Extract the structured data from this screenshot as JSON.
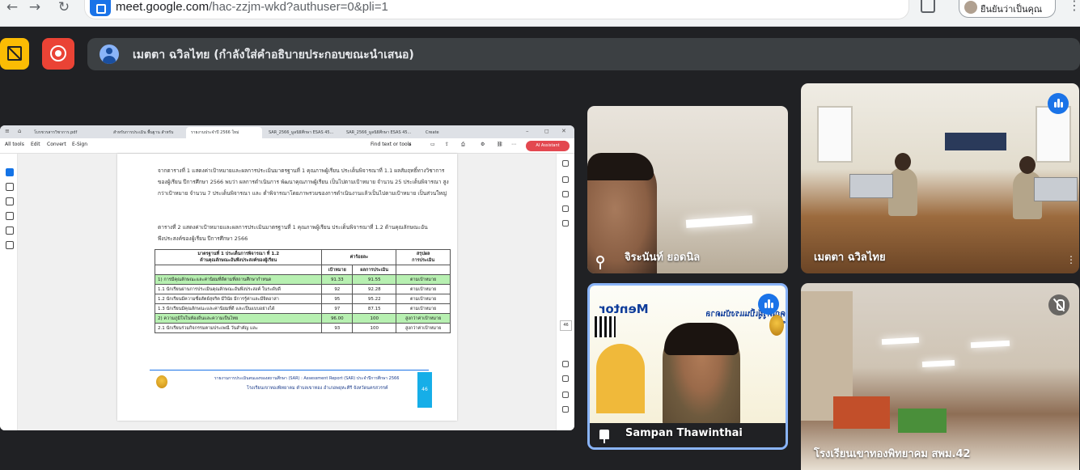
{
  "browser": {
    "url_host": "meet.google.com",
    "url_path": "/hac-zzjm-wkd?authuser=0&pli=1",
    "profile_label": "ยืนยันว่าเป็นคุณ"
  },
  "meet": {
    "presenter_title": "เมตตา ฉวิลไทย (กำลังใส่คำอธิบายประกอบขณะนำเสนอ)",
    "participants": [
      {
        "name": "จิระนันท์ ยอดนิล"
      },
      {
        "name": "เมตตา ฉวิลไทย"
      },
      {
        "name": "Sampan Thawinthai"
      },
      {
        "name": "โรงเรียนเขาทองพิทยาคม สพม.42"
      }
    ],
    "colors": {
      "accent": "#1a73e8",
      "record": "#ea4335",
      "warning": "#fbbc04",
      "pinned_border": "#8ab4f8"
    }
  },
  "shared_screen": {
    "tabs": [
      "โบรชวรสารวิชาการ.pdf",
      "สำหรับการประเมิน พื้นฐาน สำหรับ",
      "รายงานประจำปี 2566 ใหม่",
      "SAR_2566_มูลนิธิศึกษา ESAS 45...",
      "SAR_2566_มูลนิธิศึกษา ESAS 45...",
      "Create"
    ],
    "menu": [
      "All tools",
      "Edit",
      "Convert",
      "E-Sign"
    ],
    "find_text": "Find text or tools",
    "ai_assistant": "AI Assistant",
    "page_number": "46",
    "doc": {
      "para1": "จากตารางที่ 1 แสดงค่าเป้าหมายและผลการประเมินมาตรฐานที่ 1 คุณภาพผู้เรียน ประเด็นพิจารณาที่ 1.1 ผลสัมฤทธิ์ทางวิชาการของผู้เรียน ปีการศึกษา 2566 พบว่า ผลการดำเนินการ พัฒนาคุณภาพผู้เรียน เป็นไปตามเป้าหมาย จำนวน 25 ประเด็นพิจารณา สูงกว่าเป้าหมาย จำนวน 7 ประเด็นพิจารณา และ ต่ำพิจารณาโดยภาพรวมของการดำเนินงานแล้วเป็นไปตามเป้าหมาย เป็นส่วนใหญ่",
      "para2": "ตารางที่ 2 แสดงค่าเป้าหมายและผลการประเมินมาตรฐานที่ 1 คุณภาพผู้เรียน ประเด็นพิจารณาที่ 1.2 ด้านคุณลักษณะอันพึงประสงค์ของผู้เรียน ปีการศึกษา 2566",
      "table_headers": {
        "col1a": "มาตรฐานที่ 1 ประเด็นการพิจารณา ที่ 1.2",
        "col1b": "ด้านคุณลักษณะอันพึงประสงค์ของผู้เรียน",
        "col_result": "ค่าร้อยละ",
        "col_target": "เป้าหมาย",
        "col_score": "ผลการประเมิน",
        "col_summary": "สรุปผล",
        "col_summary_sub": "การประเมิน"
      },
      "rows": [
        {
          "label": "1) การมีคุณลักษณะและค่านิยมที่ดีตามที่สถานศึกษากำหนด",
          "target": "91.33",
          "score": "91.55",
          "result": "ตามเป้าหมาย",
          "hl": true
        },
        {
          "label": "1.1 นักเรียนผ่านการประเมินคุณลักษณะอันพึงประสงค์ ในระดับดี",
          "target": "92",
          "score": "92.28",
          "result": "ตามเป้าหมาย",
          "hl": false
        },
        {
          "label": "1.2 นักเรียนมีความซื่อสัตย์สุจริต มีวินัย มีการรู้ค่าและมีจิตอาสา",
          "target": "95",
          "score": "95.22",
          "result": "ตามเป้าหมาย",
          "hl": false
        },
        {
          "label": "1.3 นักเรียนมีคุณลักษณะและค่านิยมที่ดี และเป็นแบบอย่างได้",
          "target": "97",
          "score": "87.15",
          "result": "ตามเป้าหมาย",
          "hl": false
        },
        {
          "label": "2) ความภูมิใจในท้องถิ่นและความเป็นไทย",
          "target": "96.00",
          "score": "100",
          "result": "สูงกว่าค่าเป้าหมาย",
          "hl": true
        },
        {
          "label": "2.1 นักเรียนร่วมกิจกรรมตามประเพณี วันสำคัญ และ",
          "target": "93",
          "score": "100",
          "result": "สูงกว่าค่าเป้าหมาย",
          "hl": false
        }
      ],
      "footer_line1": "รายงานการประเมินตนเองของสถานศึกษา (SAR) : Assessment Report (SAR) ประจำปีการศึกษา 2566",
      "footer_line2": "โรงเรียนเขาทองพิทยาคม ตำบลเขาทอง อำเภอพยุหะคีรี จังหวัดนครสวรรค์",
      "footer_page": "46"
    }
  },
  "banner": {
    "title": "Mentor",
    "subtitle": "คุณครูผู้เป็นแรงบันดาลใจ"
  }
}
